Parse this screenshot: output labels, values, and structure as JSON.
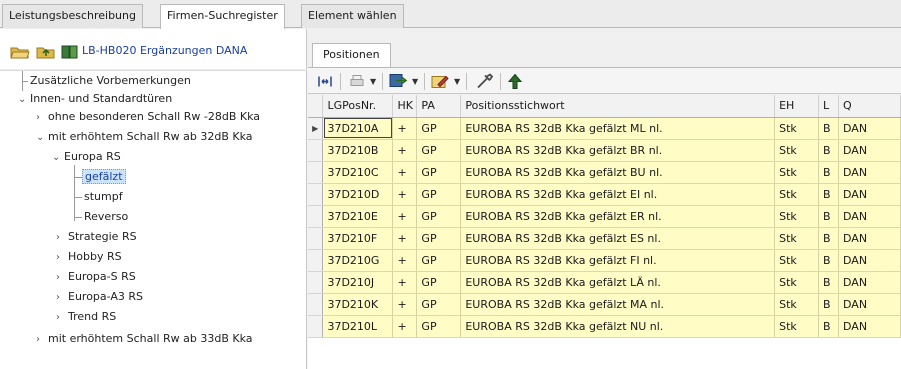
{
  "tabs": [
    {
      "label": "Leistungsbeschreibung"
    },
    {
      "label": "Firmen-Suchregister"
    },
    {
      "label": "Element wählen"
    }
  ],
  "left_header": {
    "project_label": "LB-HB020 Ergänzungen DANA",
    "icons": [
      "folder-open-icon",
      "folder-up-icon",
      "book-icon"
    ]
  },
  "tree": [
    {
      "label": "Zusätzliche Vorbemerkungen",
      "chevron": ""
    },
    {
      "label": "Innen- und Standardtüren",
      "chevron": "⌄"
    },
    {
      "label": "ohne besonderen Schall Rw -28dB Kka",
      "chevron": "›"
    },
    {
      "label": "mit erhöhtem Schall Rw ab 32dB Kka",
      "chevron": "⌄"
    },
    {
      "label": "Europa RS",
      "chevron": "⌄"
    },
    {
      "label": "gefälzt",
      "chevron": ""
    },
    {
      "label": "stumpf",
      "chevron": ""
    },
    {
      "label": "Reverso",
      "chevron": ""
    },
    {
      "label": "Strategie RS",
      "chevron": "›"
    },
    {
      "label": "Hobby RS",
      "chevron": "›"
    },
    {
      "label": "Europa-S RS",
      "chevron": "›"
    },
    {
      "label": "Europa-A3 RS",
      "chevron": "›"
    },
    {
      "label": "Trend RS",
      "chevron": "›"
    },
    {
      "label": "mit erhöhtem Schall Rw ab 33dB Kka",
      "chevron": "›"
    }
  ],
  "positions_tab": "Positionen",
  "toolbar": [
    "columns-icon",
    "print-icon",
    "export-icon",
    "edit-icon",
    "tools-icon",
    "tree-icon"
  ],
  "grid": {
    "columns": [
      "LGPosNr.",
      "HK",
      "PA",
      "Positionsstichwort",
      "EH",
      "L",
      "Q"
    ],
    "rows": [
      {
        "nr": "37D210A",
        "hk": "+",
        "pa": "GP",
        "text": "EUROBA RS 32dB Kka gefälzt ML nl.",
        "eh": "Stk",
        "l": "B",
        "q": "DAN"
      },
      {
        "nr": "37D210B",
        "hk": "+",
        "pa": "GP",
        "text": "EUROBA RS 32dB Kka gefälzt BR nl.",
        "eh": "Stk",
        "l": "B",
        "q": "DAN"
      },
      {
        "nr": "37D210C",
        "hk": "+",
        "pa": "GP",
        "text": "EUROBA RS 32dB Kka gefälzt BU nl.",
        "eh": "Stk",
        "l": "B",
        "q": "DAN"
      },
      {
        "nr": "37D210D",
        "hk": "+",
        "pa": "GP",
        "text": "EUROBA RS 32dB Kka gefälzt EI nl.",
        "eh": "Stk",
        "l": "B",
        "q": "DAN"
      },
      {
        "nr": "37D210E",
        "hk": "+",
        "pa": "GP",
        "text": "EUROBA RS 32dB Kka gefälzt ER nl.",
        "eh": "Stk",
        "l": "B",
        "q": "DAN"
      },
      {
        "nr": "37D210F",
        "hk": "+",
        "pa": "GP",
        "text": "EUROBA RS 32dB Kka gefälzt ES nl.",
        "eh": "Stk",
        "l": "B",
        "q": "DAN"
      },
      {
        "nr": "37D210G",
        "hk": "+",
        "pa": "GP",
        "text": "EUROBA RS 32dB Kka gefälzt FI nl.",
        "eh": "Stk",
        "l": "B",
        "q": "DAN"
      },
      {
        "nr": "37D210J",
        "hk": "+",
        "pa": "GP",
        "text": "EUROBA RS 32dB Kka gefälzt LÄ nl.",
        "eh": "Stk",
        "l": "B",
        "q": "DAN"
      },
      {
        "nr": "37D210K",
        "hk": "+",
        "pa": "GP",
        "text": "EUROBA RS 32dB Kka gefälzt MA nl.",
        "eh": "Stk",
        "l": "B",
        "q": "DAN"
      },
      {
        "nr": "37D210L",
        "hk": "+",
        "pa": "GP",
        "text": "EUROBA RS 32dB Kka gefälzt NU nl.",
        "eh": "Stk",
        "l": "B",
        "q": "DAN"
      }
    ]
  },
  "colors": {
    "row_bg": "#fffcc5",
    "link": "#1a3fa0",
    "selected_bg": "#cce4f7"
  }
}
